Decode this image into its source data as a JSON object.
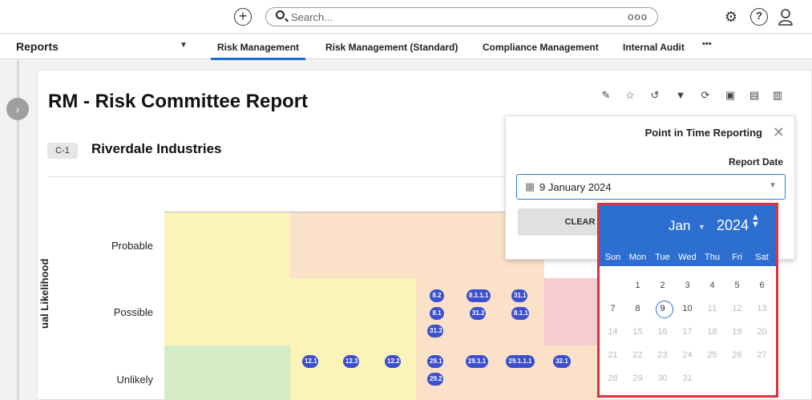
{
  "topbar": {
    "search_placeholder": "Search...",
    "search_more": "ooo"
  },
  "nav": {
    "section_label": "Reports",
    "tabs": [
      {
        "label": "Risk Management",
        "active": true
      },
      {
        "label": "Risk Management (Standard)",
        "active": false
      },
      {
        "label": "Compliance Management",
        "active": false
      },
      {
        "label": "Internal Audit",
        "active": false
      }
    ],
    "more": "•••"
  },
  "report": {
    "title": "RM - Risk Committee Report",
    "org_badge": "C-1",
    "org_name": "Riverdale Industries"
  },
  "matrix": {
    "y_axis_label": "ual Likelihood",
    "rows": [
      "Probable",
      "Possible",
      "Unlikely"
    ],
    "colors": {
      "yellow": "#fbf3b8",
      "orange": "#fbe1c8",
      "red": "#f5ccd0",
      "green": "#d3ecc4"
    },
    "possible_risks": [
      "8.2",
      "8.1.1.1",
      "31.1",
      "8.1",
      "31.2",
      "8.1.1",
      "31.3"
    ],
    "unlikely_risks": [
      "12.1",
      "12.3",
      "12.2",
      "29.1",
      "29.1.1",
      "29.1.1.1",
      "32.1",
      "29.2"
    ]
  },
  "popup": {
    "title": "Point in Time Reporting",
    "field_label": "Report Date",
    "date_value": "9 January 2024",
    "clear_label": "CLEAR"
  },
  "calendar": {
    "month": "Jan",
    "year": "2024",
    "weekdays": [
      "Sun",
      "Mon",
      "Tue",
      "Wed",
      "Thu",
      "Fri",
      "Sat"
    ],
    "selected_day": "9",
    "header_color": "#2d6fd1",
    "highlight_color": "#e2303a"
  }
}
